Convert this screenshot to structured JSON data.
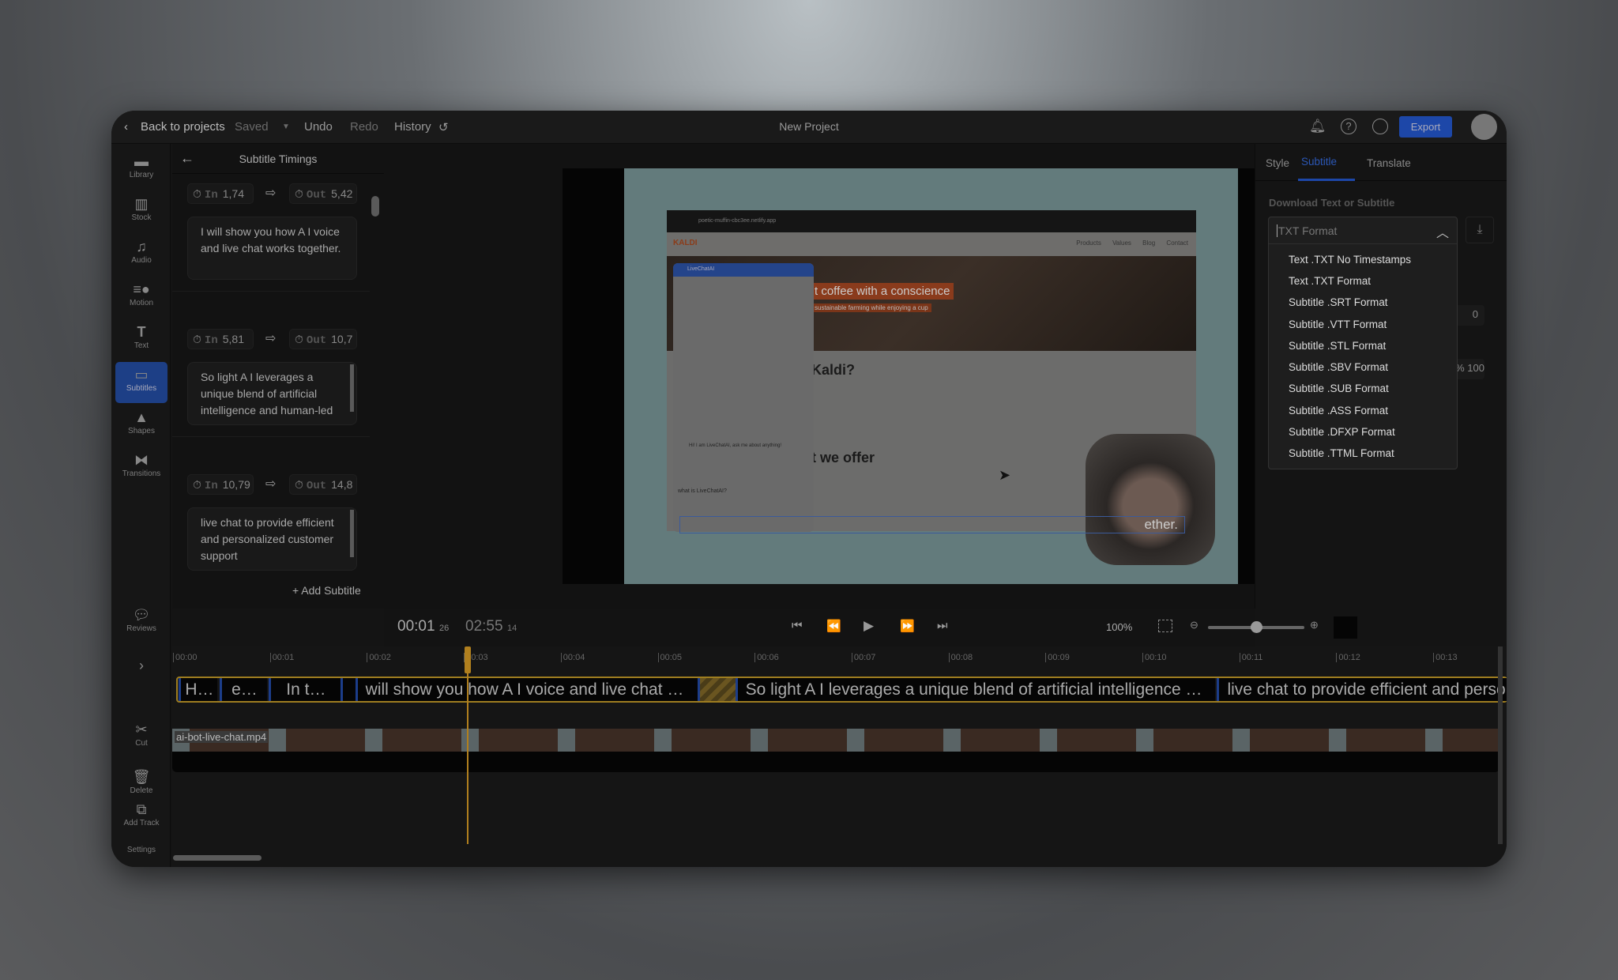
{
  "topbar": {
    "back": "Back to projects",
    "saved": "Saved",
    "undo": "Undo",
    "redo": "Redo",
    "history": "History",
    "title": "New Project",
    "export": "Export"
  },
  "sidebar": {
    "items": [
      {
        "label": "Library",
        "icon": "folder-icon"
      },
      {
        "label": "Stock",
        "icon": "books-icon"
      },
      {
        "label": "Audio",
        "icon": "music-note-icon"
      },
      {
        "label": "Motion",
        "icon": "motion-icon"
      },
      {
        "label": "Text",
        "icon": "text-icon"
      },
      {
        "label": "Subtitles",
        "icon": "subtitles-icon",
        "active": true
      },
      {
        "label": "Shapes",
        "icon": "shapes-icon"
      },
      {
        "label": "Transitions",
        "icon": "transitions-icon"
      },
      {
        "label": "Reviews",
        "icon": "reviews-icon"
      }
    ],
    "timeline_tools": {
      "cut": "Cut",
      "delete": "Delete",
      "add_track": "Add Track",
      "settings": "Settings"
    }
  },
  "subtitle_panel": {
    "title": "Subtitle Timings",
    "in_label": "In",
    "out_label": "Out",
    "add": "+ Add Subtitle",
    "entries": [
      {
        "in": "1,74",
        "out": "5,42",
        "text": "I will show you how A I voice and live chat works together."
      },
      {
        "in": "5,81",
        "out": "10,7",
        "text": "So light A I leverages a unique blend of artificial intelligence and human-led"
      },
      {
        "in": "10,79",
        "out": "14,8",
        "text": "live chat to provide efficient and personalized customer support"
      }
    ]
  },
  "preview": {
    "site_brand": "KALDI",
    "nav": [
      "Products",
      "Values",
      "Blog",
      "Contact"
    ],
    "hero": "t coffee with a conscience",
    "hero_sub": "sustainable farming while enjoying a cup",
    "heading1": "Kaldi?",
    "heading2": "t we offer",
    "chat_title": "LiveChatAI",
    "chat_msg": "Hi! I am LiveChatAI, ask me about anything!",
    "chat_input": "what is LiveChatAI?",
    "url": "poetic-muffin-cbc3ee.netlify.app",
    "caption": "ether."
  },
  "controls": {
    "current_time": "00:01",
    "current_frame": "26",
    "total_time": "02:55",
    "total_frame": "14",
    "zoom": "100%",
    "zoom_slider_fraction": 0.5
  },
  "timeline": {
    "ticks": [
      "00:00",
      "00:01",
      "00:02",
      "00:03",
      "00:04",
      "00:05",
      "00:06",
      "00:07",
      "00:08",
      "00:09",
      "00:10",
      "00:11",
      "00:12",
      "00:13"
    ],
    "subtitle_clips": [
      "H…",
      "e…",
      "In t…",
      "",
      "will show you how A I voice and live chat …",
      "",
      "So light A I leverages a unique blend of artificial intelligence …",
      "live chat to provide efficient and personalized"
    ],
    "video_clip": "ai-bot-live-chat.mp4"
  },
  "right_panel": {
    "tabs": [
      "Style",
      "Subtitle",
      "Translate"
    ],
    "active_tab": "Subtitle",
    "section": "Download Text or Subtitle",
    "select_value": "TXT Format",
    "options": [
      "Text .TXT No Timestamps",
      "Text .TXT Format",
      "Subtitle .SRT Format",
      "Subtitle .VTT Format",
      "Subtitle .STL Format",
      "Subtitle .SBV Format",
      "Subtitle .SUB Format",
      "Subtitle .ASS Format",
      "Subtitle .DFXP Format",
      "Subtitle .TTML Format"
    ],
    "hidden_field_1": "0",
    "hidden_field_2": "100 %"
  },
  "colors": {
    "accent": "#1d47a8",
    "playhead": "#b07f1e",
    "track_border": "#9e7d20"
  }
}
